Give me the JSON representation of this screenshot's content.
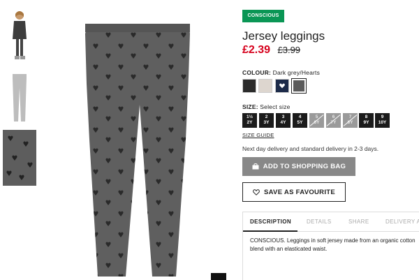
{
  "badge": "CONSCIOUS",
  "product": {
    "title": "Jersey leggings",
    "price": "£2.39",
    "old_price": "£3.99"
  },
  "colour": {
    "label": "COLOUR:",
    "value": "Dark grey/Hearts",
    "swatches": [
      {
        "name": "black",
        "color": "#2b2b2b"
      },
      {
        "name": "light-beige",
        "color": "#ddd6cf"
      },
      {
        "name": "navy-hearts",
        "color": "#1d2b4a"
      },
      {
        "name": "dark-grey-hearts",
        "color": "#5b5b5b",
        "selected": true
      }
    ]
  },
  "size": {
    "label": "SIZE:",
    "value": "Select size",
    "options": [
      {
        "top": "1½",
        "bottom": "2Y",
        "available": true
      },
      {
        "top": "2",
        "bottom": "3Y",
        "available": true
      },
      {
        "top": "3",
        "bottom": "4Y",
        "available": true
      },
      {
        "top": "4",
        "bottom": "5Y",
        "available": true
      },
      {
        "top": "5",
        "bottom": "6Y",
        "available": false
      },
      {
        "top": "6",
        "bottom": "7Y",
        "available": false
      },
      {
        "top": "7",
        "bottom": "8Y",
        "available": false
      },
      {
        "top": "8",
        "bottom": "9Y",
        "available": true
      },
      {
        "top": "9",
        "bottom": "10Y",
        "available": true
      }
    ],
    "guide_label": "SIZE GUIDE"
  },
  "delivery_text": "Next day delivery and standard delivery in 2-3 days.",
  "buttons": {
    "add_to_bag": "ADD TO SHOPPING BAG",
    "favourite": "SAVE AS FAVOURITE"
  },
  "tabs": [
    {
      "label": "DESCRIPTION",
      "active": true
    },
    {
      "label": "DETAILS",
      "active": false
    },
    {
      "label": "SHARE",
      "active": false
    },
    {
      "label": "DELIVERY A",
      "active": false
    }
  ],
  "description": "CONSCIOUS. Leggings in soft jersey made from an organic cotton blend with an elasticated waist.",
  "colors": {
    "badge_green": "#0a9655",
    "sale_red": "#d6001c",
    "button_grey": "#888888"
  }
}
